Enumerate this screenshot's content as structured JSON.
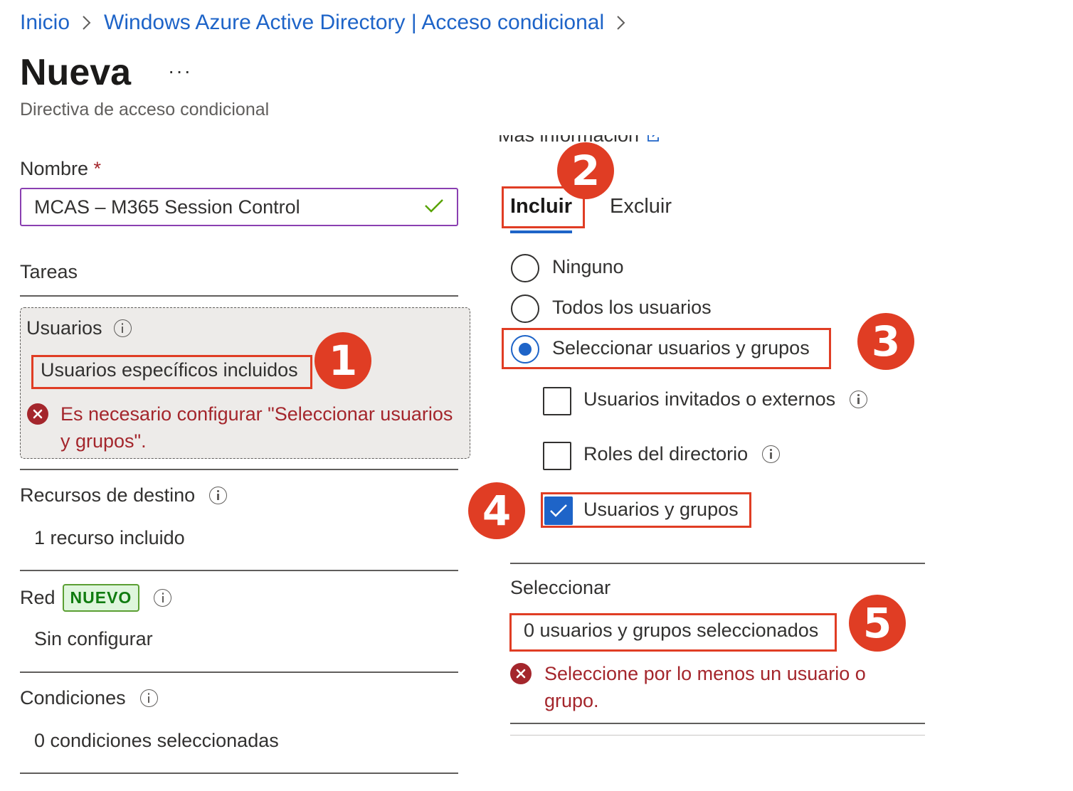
{
  "breadcrumb": {
    "home": "Inicio",
    "parent": "Windows Azure Active Directory | Acceso condicional"
  },
  "page": {
    "title": "Nueva",
    "more": "···",
    "subtitle": "Directiva de acceso condicional"
  },
  "form": {
    "name_label": "Nombre",
    "required_mark": "*",
    "name_value": "MCAS – M365 Session Control"
  },
  "tasks": {
    "heading": "Tareas",
    "users": {
      "label": "Usuarios",
      "link": "Usuarios específicos incluidos",
      "error": "Es necesario configurar \"Seleccionar usuarios y grupos\"."
    },
    "resources": {
      "label": "Recursos de destino",
      "link": "1 recurso incluido"
    },
    "network": {
      "label": "Red",
      "badge": "NUEVO",
      "link": "Sin configurar"
    },
    "conditions": {
      "label": "Condiciones",
      "link": "0 condiciones seleccionadas"
    }
  },
  "right_panel": {
    "more_info": "Más información",
    "tabs": [
      "Incluir",
      "Excluir"
    ],
    "active_tab": "Incluir",
    "radios": [
      {
        "label": "Ninguno",
        "selected": false
      },
      {
        "label": "Todos los usuarios",
        "selected": false
      },
      {
        "label": "Seleccionar usuarios y grupos",
        "selected": true
      }
    ],
    "checkboxes": [
      {
        "label": "Usuarios invitados o externos",
        "checked": false
      },
      {
        "label": "Roles del directorio",
        "checked": false
      },
      {
        "label": "Usuarios y grupos",
        "checked": true
      }
    ],
    "select_label": "Seleccionar",
    "select_link": "0 usuarios y grupos seleccionados",
    "select_error": "Seleccione por lo menos un usuario o grupo."
  },
  "annotations": [
    "1",
    "2",
    "3",
    "4",
    "5"
  ],
  "colors": {
    "link": "#1e64c8",
    "error": "#a4262c",
    "highlight": "#e03d24",
    "input_border": "#8a3fb1",
    "new_badge": "#107c10"
  }
}
